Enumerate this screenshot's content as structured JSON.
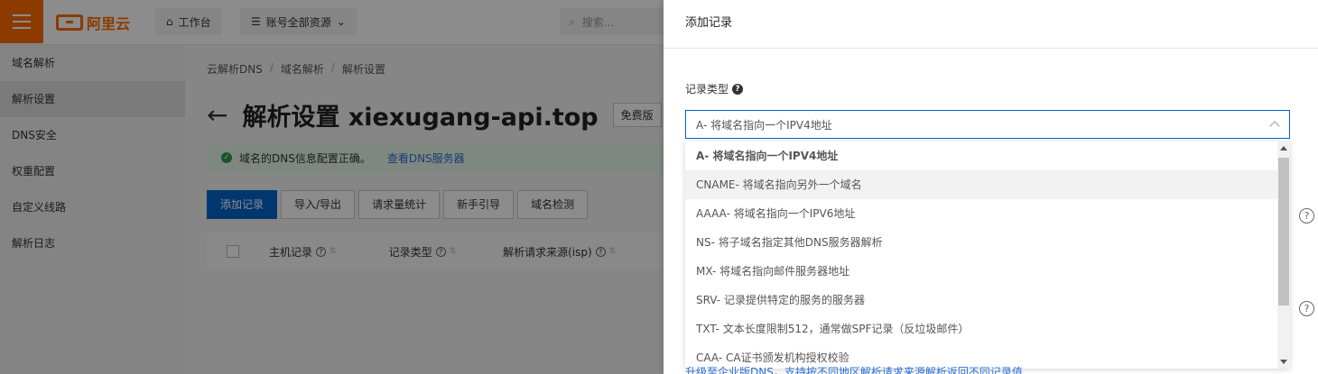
{
  "topbar": {
    "logo_text": "阿里云",
    "workbench": "工作台",
    "resources": "账号全部资源",
    "search_placeholder": "搜索..."
  },
  "sidebar": {
    "items": [
      {
        "label": "域名解析"
      },
      {
        "label": "解析设置",
        "active": true
      },
      {
        "label": "DNS安全"
      },
      {
        "label": "权重配置"
      },
      {
        "label": "自定义线路"
      },
      {
        "label": "解析日志"
      }
    ]
  },
  "main": {
    "breadcrumb": [
      "云解析DNS",
      "域名解析",
      "解析设置"
    ],
    "title": "解析设置 xiexugang-api.top",
    "badge": "免费版",
    "notice": "域名的DNS信息配置正确。",
    "notice_link": "查看DNS服务器",
    "buttons": [
      "添加记录",
      "导入/导出",
      "请求量统计",
      "新手引导",
      "域名检测"
    ],
    "columns": [
      "主机记录",
      "记录类型",
      "解析请求来源(isp)"
    ]
  },
  "drawer": {
    "title": "添加记录",
    "field_label": "记录类型",
    "select_value": "A- 将域名指向一个IPV4地址",
    "options": [
      "A- 将域名指向一个IPV4地址",
      "CNAME- 将域名指向另外一个域名",
      "AAAA- 将域名指向一个IPV6地址",
      "NS- 将子域名指定其他DNS服务器解析",
      "MX- 将域名指向邮件服务器地址",
      "SRV- 记录提供特定的服务的服务器",
      "TXT- 文本长度限制512，通常做SPF记录（反垃圾邮件）",
      "CAA- CA证书颁发机构授权校验"
    ],
    "selected_index": 0,
    "hovered_index": 1,
    "footer_peek": "升级至企业版DNS，支持按不同地区解析请求来源解析返回不同记录值"
  }
}
